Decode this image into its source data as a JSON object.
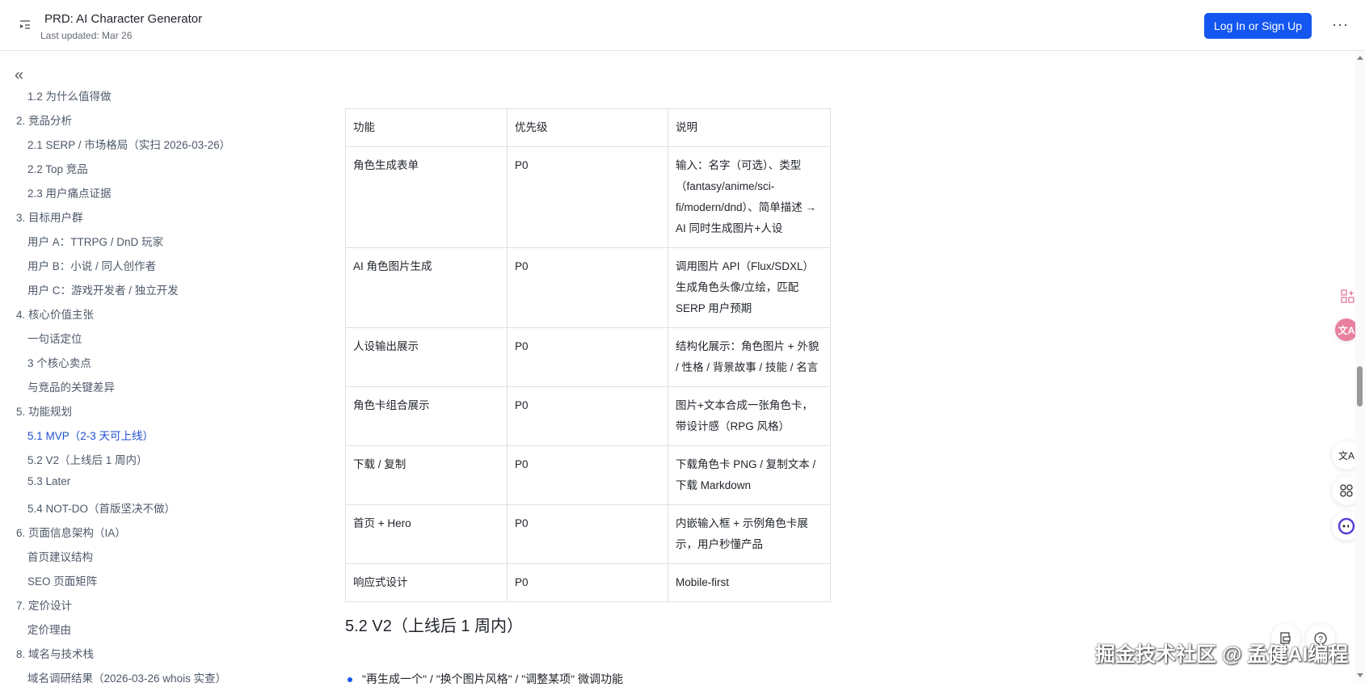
{
  "header": {
    "title": "PRD: AI Character Generator",
    "updated": "Last updated: Mar 26",
    "login_label": "Log In or Sign Up",
    "more_label": "···"
  },
  "sidebar": {
    "collapse_label": "«",
    "items": [
      {
        "label": "1.2 为什么值得做",
        "level": 2
      },
      {
        "label": "2. 竞品分析",
        "level": 1
      },
      {
        "label": "2.1 SERP / 市场格局（实扫 2026-03-26）",
        "level": 2
      },
      {
        "label": "2.2 Top 竞品",
        "level": 2
      },
      {
        "label": "2.3 用户痛点证据",
        "level": 2
      },
      {
        "label": "3. 目标用户群",
        "level": 1
      },
      {
        "label": "用户 A：TTRPG / DnD 玩家",
        "level": 2
      },
      {
        "label": "用户 B：小说 / 同人创作者",
        "level": 2
      },
      {
        "label": "用户 C：游戏开发者 / 独立开发",
        "level": 2
      },
      {
        "label": "4. 核心价值主张",
        "level": 1
      },
      {
        "label": "一句话定位",
        "level": 2
      },
      {
        "label": "3 个核心卖点",
        "level": 2
      },
      {
        "label": "与竞品的关键差异",
        "level": 2
      },
      {
        "label": "5. 功能规划",
        "level": 1
      },
      {
        "label": "5.1 MVP（2-3 天可上线）",
        "level": 2,
        "active": true
      },
      {
        "label": "5.2 V2（上线后 1 周内）",
        "level": 2
      },
      {
        "label": "5.3 Later",
        "level": 2
      },
      {
        "label": "5.4 NOT-DO（首版坚决不做）",
        "level": 2
      },
      {
        "label": "6. 页面信息架构（IA）",
        "level": 1
      },
      {
        "label": "首页建议结构",
        "level": 2
      },
      {
        "label": "SEO 页面矩阵",
        "level": 2
      },
      {
        "label": "7. 定价设计",
        "level": 1
      },
      {
        "label": "定价理由",
        "level": 2
      },
      {
        "label": "8. 域名与技术栈",
        "level": 1
      },
      {
        "label": "域名调研结果（2026-03-26 whois 实查）",
        "level": 2
      }
    ]
  },
  "table": {
    "headers": [
      "功能",
      "优先级",
      "说明"
    ],
    "rows": [
      [
        "角色生成表单",
        "P0",
        "输入：名字（可选）、类型（fantasy/anime/sci-fi/modern/dnd）、简单描述 → AI 同时生成图片+人设"
      ],
      [
        "AI 角色图片生成",
        "P0",
        "调用图片 API（Flux/SDXL）生成角色头像/立绘，匹配 SERP 用户预期"
      ],
      [
        "人设输出展示",
        "P0",
        "结构化展示：角色图片 + 外貌 / 性格 / 背景故事 / 技能 / 名言"
      ],
      [
        "角色卡组合展示",
        "P0",
        "图片+文本合成一张角色卡，带设计感（RPG 风格）"
      ],
      [
        "下载 / 复制",
        "P0",
        "下载角色卡 PNG / 复制文本 / 下载 Markdown"
      ],
      [
        "首页 + Hero",
        "P0",
        "内嵌输入框 + 示例角色卡展示，用户秒懂产品"
      ],
      [
        "响应式设计",
        "P0",
        "Mobile-first"
      ]
    ]
  },
  "section": {
    "heading": "5.2 V2（上线后 1 周内）",
    "bullets": [
      "\"再生成一个\" / \"换个图片风格\" / \"调整某项\" 微调功能"
    ]
  },
  "watermark": "掘金技术社区 @ 孟健AI编程",
  "colors": {
    "accent": "#1456f0",
    "active_toc": "#1f4fd1"
  }
}
